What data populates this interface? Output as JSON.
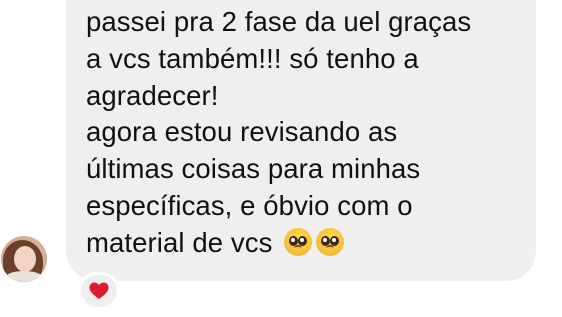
{
  "message": {
    "lines": [
      "passei pra 2 fase da uel graças",
      "a vcs também!!! só tenho a",
      "agradecer!",
      "agora estou revisando as",
      "últimas coisas para minhas",
      "específicas, e óbvio com o",
      "material de vcs"
    ],
    "emojis": [
      "pleading-face-emoji",
      "pleading-face-emoji"
    ]
  },
  "reaction": {
    "icon": "red-heart-icon",
    "color": "#e01a2b"
  },
  "colors": {
    "bubble": "#efefef",
    "text": "#111111"
  }
}
